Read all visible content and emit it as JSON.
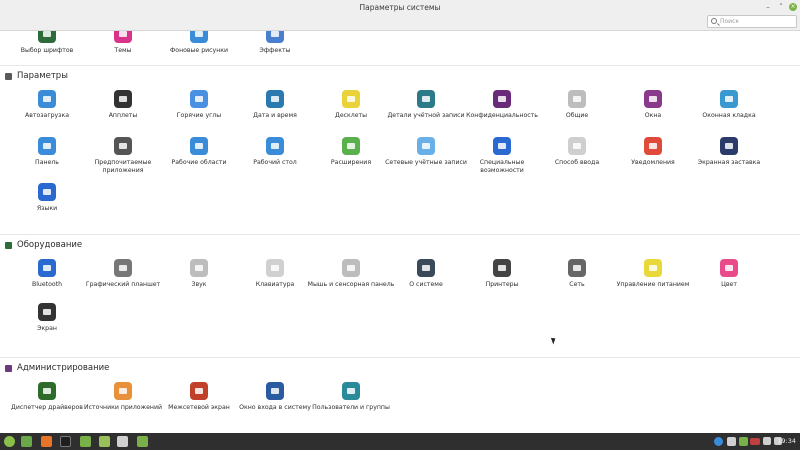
{
  "window": {
    "title": "Параметры системы",
    "search_placeholder": "Поиск"
  },
  "top_row": [
    {
      "label": "Выбор шрифтов",
      "icon": "font-icon",
      "color": "#2e6b3a"
    },
    {
      "label": "Темы",
      "icon": "themes-icon",
      "color": "#d8348a"
    },
    {
      "label": "Фоновые рисунки",
      "icon": "wallpaper-icon",
      "color": "#3a8bd8"
    },
    {
      "label": "Эффекты",
      "icon": "effects-icon",
      "color": "#4a7fd0"
    }
  ],
  "sections": {
    "params": {
      "title": "Параметры",
      "color": "#5a5a5a"
    },
    "hardware": {
      "title": "Оборудование",
      "color": "#2e6b3a"
    },
    "admin": {
      "title": "Администрирование",
      "color": "#6b3a7a"
    }
  },
  "params_items": [
    {
      "label": "Автозагрузка",
      "icon": "startup-icon",
      "color": "#3a8bd8"
    },
    {
      "label": "Апплеты",
      "icon": "applets-icon",
      "color": "#333333"
    },
    {
      "label": "Горячие углы",
      "icon": "hot-corners-icon",
      "color": "#4a90e2"
    },
    {
      "label": "Дата и время",
      "icon": "clock-icon",
      "color": "#2a7ab0"
    },
    {
      "label": "Десклеты",
      "icon": "desklets-icon",
      "color": "#e9d23a"
    },
    {
      "label": "Детали учётной записи",
      "icon": "account-icon",
      "color": "#2a7a8a"
    },
    {
      "label": "Конфиденциальность",
      "icon": "privacy-icon",
      "color": "#6a2a7a"
    },
    {
      "label": "Общие",
      "icon": "general-icon",
      "color": "#bdbdbd"
    },
    {
      "label": "Окна",
      "icon": "windows-icon",
      "color": "#8a3a8a"
    },
    {
      "label": "Оконная кладка",
      "icon": "tiling-icon",
      "color": "#3a9ad0"
    },
    {
      "label": "Панель",
      "icon": "panel-icon",
      "color": "#3a8bd8"
    },
    {
      "label": "Предпочитаемые приложения",
      "icon": "preferred-apps-icon",
      "color": "#555555"
    },
    {
      "label": "Рабочие области",
      "icon": "workspaces-icon",
      "color": "#3a8bd8"
    },
    {
      "label": "Рабочий стол",
      "icon": "desktop-icon",
      "color": "#3a8bd8"
    },
    {
      "label": "Расширения",
      "icon": "extensions-icon",
      "color": "#5ab04a"
    },
    {
      "label": "Сетевые учётные записи",
      "icon": "online-accounts-icon",
      "color": "#6ab0e8"
    },
    {
      "label": "Специальные возможности",
      "icon": "accessibility-icon",
      "color": "#2a6ad0"
    },
    {
      "label": "Способ ввода",
      "icon": "input-method-icon",
      "color": "#cfcfcf"
    },
    {
      "label": "Уведомления",
      "icon": "notifications-icon",
      "color": "#e04a3a"
    },
    {
      "label": "Экранная заставка",
      "icon": "screensaver-icon",
      "color": "#2a3a6a"
    },
    {
      "label": "Языки",
      "icon": "languages-icon",
      "color": "#2a6ad0"
    }
  ],
  "hardware_items": [
    {
      "label": "Bluetooth",
      "icon": "bluetooth-icon",
      "color": "#2a6ad0"
    },
    {
      "label": "Графический планшет",
      "icon": "tablet-icon",
      "color": "#777777"
    },
    {
      "label": "Звук",
      "icon": "sound-icon",
      "color": "#bdbdbd"
    },
    {
      "label": "Клавиатура",
      "icon": "keyboard-icon",
      "color": "#d0d0d0"
    },
    {
      "label": "Мышь и сенсорная панель",
      "icon": "mouse-icon",
      "color": "#bdbdbd"
    },
    {
      "label": "О системе",
      "icon": "gear-icon",
      "color": "#3a4a5a"
    },
    {
      "label": "Принтеры",
      "icon": "printer-icon",
      "color": "#444444"
    },
    {
      "label": "Сеть",
      "icon": "network-icon",
      "color": "#666666"
    },
    {
      "label": "Управление питанием",
      "icon": "power-icon",
      "color": "#e8d83a"
    },
    {
      "label": "Цвет",
      "icon": "color-icon",
      "color": "#e84a8a"
    },
    {
      "label": "Экран",
      "icon": "display-icon",
      "color": "#333333"
    }
  ],
  "admin_items": [
    {
      "label": "Диспетчер драйверов",
      "icon": "driver-icon",
      "color": "#2e6b2a"
    },
    {
      "label": "Источники приложений",
      "icon": "software-sources-icon",
      "color": "#e8903a"
    },
    {
      "label": "Межсетевой экран",
      "icon": "firewall-icon",
      "color": "#c0402a"
    },
    {
      "label": "Окно входа в систему",
      "icon": "login-window-icon",
      "color": "#2a5aa0"
    },
    {
      "label": "Пользователи и группы",
      "icon": "users-icon",
      "color": "#2a8a9a"
    }
  ],
  "taskbar": {
    "clock": "19:34"
  }
}
